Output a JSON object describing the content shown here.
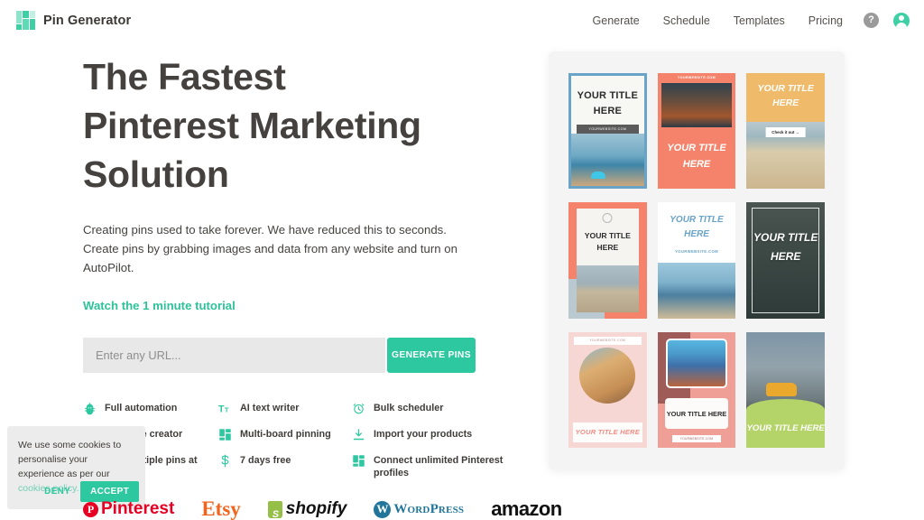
{
  "header": {
    "brand": "Pin Generator",
    "nav": [
      {
        "label": "Generate"
      },
      {
        "label": "Schedule"
      },
      {
        "label": "Templates"
      },
      {
        "label": "Pricing"
      }
    ],
    "help_glyph": "?",
    "accent_color": "#2ec8a0"
  },
  "hero": {
    "heading_line1": "The Fastest",
    "heading_line2": "Pinterest Marketing",
    "heading_line3": "Solution",
    "subtitle": "Creating pins used to take forever. We have reduced this to seconds. Create pins by grabbing images and data from any website and turn on AutoPilot.",
    "tutorial_link": "Watch the 1 minute tutorial",
    "url_placeholder": "Enter any URL...",
    "url_value": "",
    "generate_button": "GENERATE PINS"
  },
  "features": [
    {
      "icon": "robot-icon",
      "label": "Full automation"
    },
    {
      "icon": "text-writer-icon",
      "label": "AI text writer"
    },
    {
      "icon": "clock-icon",
      "label": "Bulk scheduler"
    },
    {
      "icon": "compass-icon",
      "label": "Template creator"
    },
    {
      "icon": "grid-icon",
      "label": "Multi-board pinning"
    },
    {
      "icon": "download-icon",
      "label": "Import your products"
    },
    {
      "icon": "pencil-icon",
      "label": "Edit multiple pins at"
    },
    {
      "icon": "dollar-icon",
      "label": "7 days free"
    },
    {
      "icon": "grid-icon",
      "label": "Connect unlimited Pinterest profiles"
    }
  ],
  "cookie_banner": {
    "text_before_link": "We use some cookies to personalise your experience as per our ",
    "link_text": "cookies policy.",
    "deny_button": "DENY",
    "accept_button": "ACCEPT"
  },
  "partners": [
    {
      "name": "Pinterest",
      "mark": "P"
    },
    {
      "name": "Etsy"
    },
    {
      "name": "shopify",
      "mark": "S"
    },
    {
      "name": "WordPress",
      "mark": "W"
    },
    {
      "name": "amazon"
    }
  ],
  "pins": [
    {
      "id": "pin-1",
      "style": "blue-border-photo-bottom",
      "title": "YOUR TITLE HERE",
      "url_label": "YOURWEBSITE.COM"
    },
    {
      "id": "pin-2",
      "style": "coral-photo-top",
      "title": "YOUR TITLE HERE",
      "url_label": "YOURWEBSITE.COM"
    },
    {
      "id": "pin-3",
      "style": "orange-band-beach",
      "title": "YOUR TITLE HERE",
      "cta_label": "Check it out →"
    },
    {
      "id": "pin-4",
      "style": "coral-frame-white-inner",
      "title": "YOUR TITLE HERE"
    },
    {
      "id": "pin-5",
      "style": "white-blue-italic",
      "title": "YOUR TITLE HERE",
      "url_label": "YOURWEBSITE.COM"
    },
    {
      "id": "pin-6",
      "style": "dark-photo-white-frame",
      "title": "YOUR TITLE HERE"
    },
    {
      "id": "pin-7",
      "style": "pink-circle-photo",
      "title": "YOUR TITLE HERE",
      "url_label": "YOURWEBSITE.COM"
    },
    {
      "id": "pin-8",
      "style": "rose-card-stack",
      "title": "YOUR TITLE HERE",
      "url_label": "YOURWEBSITE.COM"
    },
    {
      "id": "pin-9",
      "style": "green-wave-van",
      "title": "YOUR TITLE HERE"
    }
  ]
}
